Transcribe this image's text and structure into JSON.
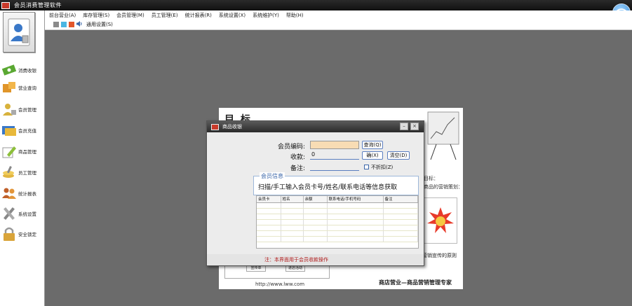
{
  "window": {
    "title": "会员消费管理软件"
  },
  "menu": {
    "items": [
      "前台营业(A)",
      "库存管理(S)",
      "会员管理(M)",
      "员工管理(E)",
      "统计报表(R)",
      "系统设置(X)",
      "系统维护(Y)",
      "帮助(H)"
    ],
    "toolbar_label": "通用设置(S)"
  },
  "sidebar": {
    "items": [
      {
        "label": "消费收银",
        "icon": "money-icon",
        "color": "#5aa832"
      },
      {
        "label": "营业查询",
        "icon": "boxes-icon",
        "color": "#e0952a"
      },
      {
        "label": "会员管理",
        "icon": "member-icon",
        "color": "#d8b23c"
      },
      {
        "label": "会员充值",
        "icon": "card-icon",
        "color": "#3a78c8"
      },
      {
        "label": "商品管理",
        "icon": "edit-icon",
        "color": "#8cbf3a"
      },
      {
        "label": "员工管理",
        "icon": "coins-icon",
        "color": "#e2b640"
      },
      {
        "label": "统计报表",
        "icon": "users-icon",
        "color": "#c0602a"
      },
      {
        "label": "系统设置",
        "icon": "tools-icon",
        "color": "#888888"
      },
      {
        "label": "安全锁定",
        "icon": "lock-icon",
        "color": "#d9a43a"
      }
    ]
  },
  "background_doc": {
    "heading": "目 标 ...",
    "side_note1": "目标：",
    "side_note2": "商品的营销策划：",
    "note3": "营销宣传的原则",
    "button1": "宣传单",
    "button2": "进店活动",
    "url": "http://www.lww.com",
    "footer": "商店营业—商品营销管理专家"
  },
  "dialog": {
    "title": "商品收银",
    "member_no_label": "会员编码:",
    "member_no_value": "",
    "amount_label": "收款:",
    "amount_value": "0",
    "note_label": "备注:",
    "note_value": "",
    "search_button": "查询(Q)",
    "ok_button": "确(X)",
    "cancel_button": "清空(D)",
    "checkbox_label": "不折扣(Z)",
    "info_caption": "会员信息",
    "info_text": "扫描/手工输入会员卡号/姓名/联系电话等信息获取",
    "table_headers": [
      "会员卡",
      "姓名",
      "余额",
      "联系电话/手机号码",
      "备注"
    ],
    "status_text": "注：本界面用于会员收款操作"
  },
  "colors": {
    "accent": "#3a66a8",
    "workspace": "#6b6b6b",
    "member_field": "#f8dcb4",
    "status_text": "#b01a1a"
  }
}
